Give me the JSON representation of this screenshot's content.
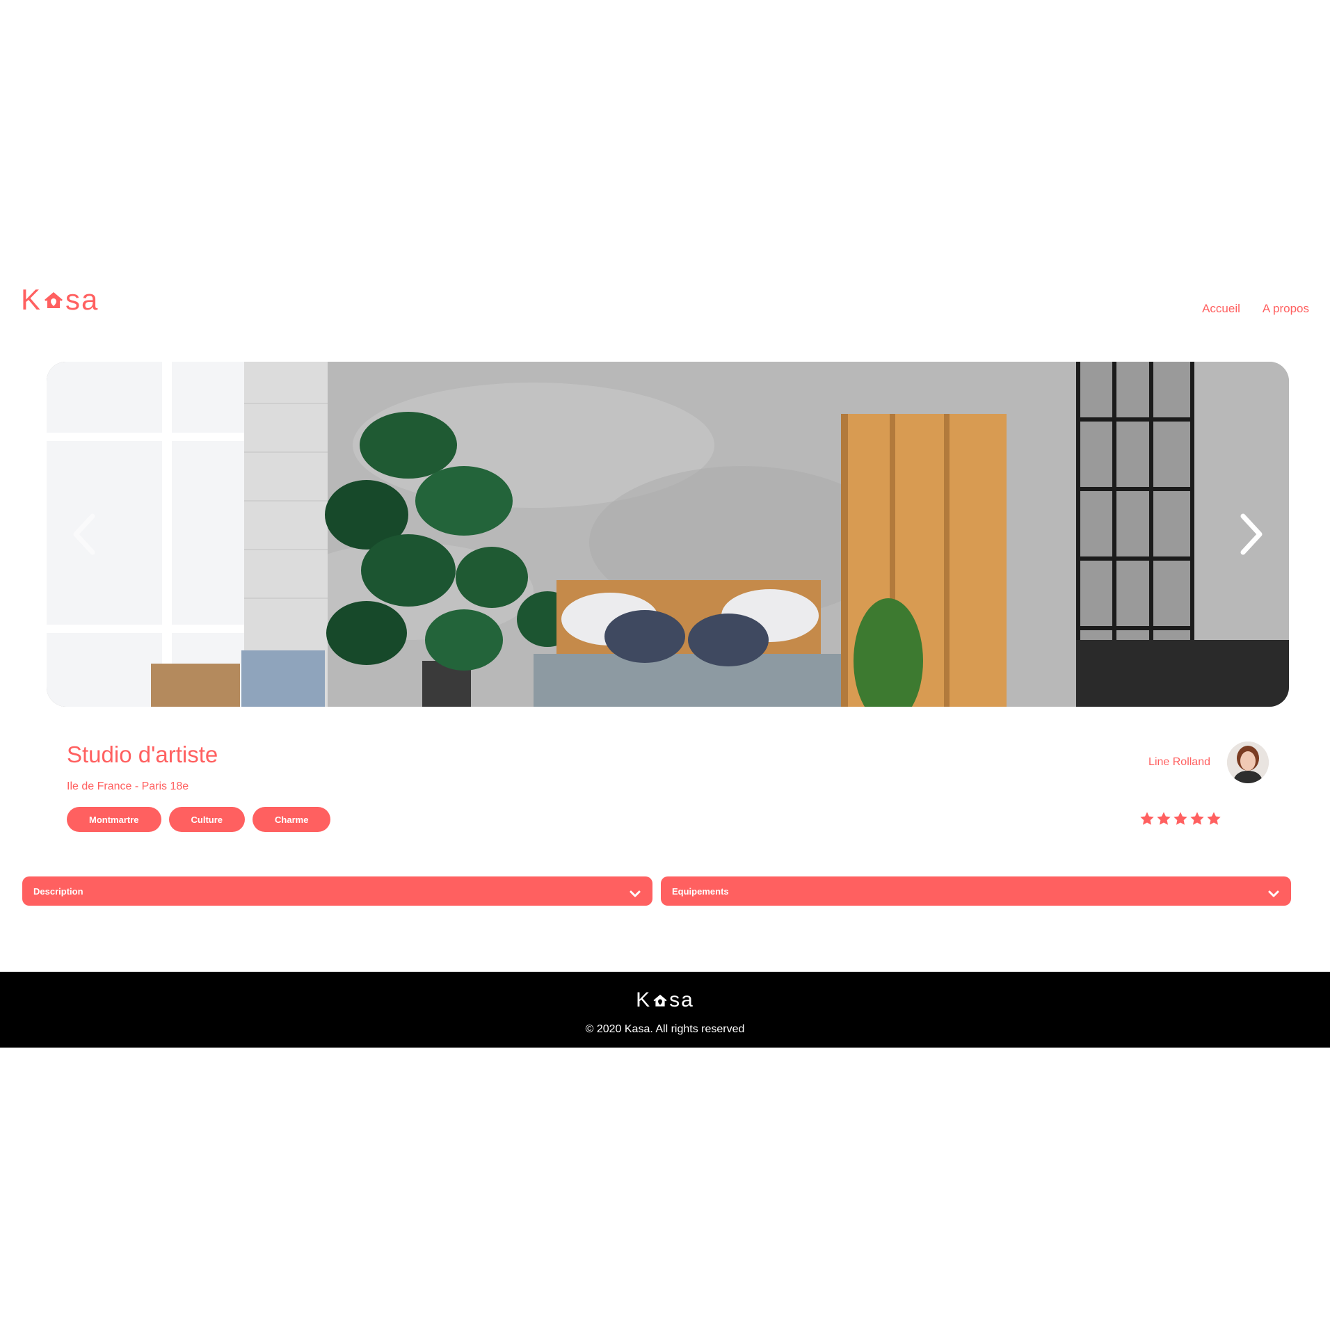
{
  "header": {
    "logo": {
      "text_before": "K",
      "text_after": "sa",
      "icon": "house-icon"
    },
    "nav": [
      {
        "label": "Accueil"
      },
      {
        "label": "A propos"
      }
    ]
  },
  "gallery": {
    "prev_icon": "chevron-left-icon",
    "next_icon": "chevron-right-icon"
  },
  "listing": {
    "title": "Studio d'artiste",
    "location": "Ile de France - Paris 18e",
    "tags": [
      "Montmartre",
      "Culture",
      "Charme"
    ],
    "host": {
      "name": "Line Rolland"
    },
    "rating": {
      "value": 5,
      "max": 5,
      "icon": "star-icon"
    }
  },
  "collapses": [
    {
      "label": "Description",
      "icon": "chevron-down-icon"
    },
    {
      "label": "Equipements",
      "icon": "chevron-down-icon"
    }
  ],
  "footer": {
    "logo": {
      "text_before": "K",
      "text_after": "sa"
    },
    "copyright": "© 2020 Kasa. All rights reserved"
  },
  "colors": {
    "accent": "#FF6060",
    "background": "#FFFFFF",
    "footer_bg": "#000000",
    "footer_text": "#FFFFFF"
  }
}
